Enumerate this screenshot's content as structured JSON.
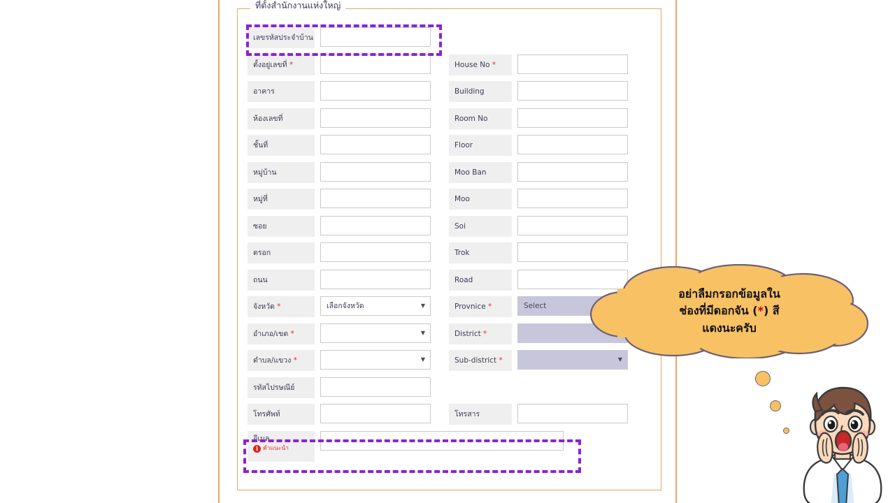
{
  "fieldset": {
    "legend": "ที่ตั้งสำนักงานแห่งใหญ่"
  },
  "form": {
    "rows": [
      {
        "th_label": "เลขรหัสประจำบ้าน",
        "th_required": true,
        "th_control": "text",
        "th_value": "",
        "en_label": "",
        "en_required": false,
        "en_control": "none",
        "en_value": "",
        "highlight": true
      },
      {
        "th_label": "ตั้งอยู่เลขที่",
        "th_required": true,
        "th_control": "text",
        "th_value": "",
        "en_label": "House No",
        "en_required": true,
        "en_control": "text",
        "en_value": ""
      },
      {
        "th_label": "อาคาร",
        "th_required": false,
        "th_control": "text",
        "th_value": "",
        "en_label": "Building",
        "en_required": false,
        "en_control": "text",
        "en_value": ""
      },
      {
        "th_label": "ห้องเลขที่",
        "th_required": false,
        "th_control": "text",
        "th_value": "",
        "en_label": "Room No",
        "en_required": false,
        "en_control": "text",
        "en_value": ""
      },
      {
        "th_label": "ชั้นที่",
        "th_required": false,
        "th_control": "text",
        "th_value": "",
        "en_label": "Floor",
        "en_required": false,
        "en_control": "text",
        "en_value": ""
      },
      {
        "th_label": "หมู่บ้าน",
        "th_required": false,
        "th_control": "text",
        "th_value": "",
        "en_label": "Moo Ban",
        "en_required": false,
        "en_control": "text",
        "en_value": ""
      },
      {
        "th_label": "หมู่ที่",
        "th_required": false,
        "th_control": "text",
        "th_value": "",
        "en_label": "Moo",
        "en_required": false,
        "en_control": "text",
        "en_value": ""
      },
      {
        "th_label": "ซอย",
        "th_required": false,
        "th_control": "text",
        "th_value": "",
        "en_label": "Soi",
        "en_required": false,
        "en_control": "text",
        "en_value": ""
      },
      {
        "th_label": "ตรอก",
        "th_required": false,
        "th_control": "text",
        "th_value": "",
        "en_label": "Trok",
        "en_required": false,
        "en_control": "text",
        "en_value": ""
      },
      {
        "th_label": "ถนน",
        "th_required": false,
        "th_control": "text",
        "th_value": "",
        "en_label": "Road",
        "en_required": false,
        "en_control": "text",
        "en_value": ""
      },
      {
        "th_label": "จังหวัด",
        "th_required": true,
        "th_control": "select",
        "th_value": "เลือกจังหวัด",
        "en_label": "Provnice",
        "en_required": true,
        "en_control": "select-lav",
        "en_value": "Select"
      },
      {
        "th_label": "อำเภอ/เขต",
        "th_required": true,
        "th_control": "select",
        "th_value": "",
        "en_label": "District",
        "en_required": true,
        "en_control": "select-lav",
        "en_value": ""
      },
      {
        "th_label": "ตำบล/แขวง",
        "th_required": true,
        "th_control": "select",
        "th_value": "",
        "en_label": "Sub-district",
        "en_required": true,
        "en_control": "select-lav",
        "en_value": ""
      },
      {
        "th_label": "รหัสไปรษณีย์",
        "th_required": false,
        "th_control": "text",
        "th_value": "",
        "en_label": "",
        "en_required": false,
        "en_control": "none",
        "en_value": ""
      },
      {
        "th_label": "โทรศัพท์",
        "th_required": false,
        "th_control": "text",
        "th_value": "",
        "en_label": "โทรสาร",
        "en_required": false,
        "en_control": "text",
        "en_value": ""
      }
    ],
    "email_row": {
      "label": "อีเมล",
      "hint": "คำแนะนำ",
      "hint_icon": "info-icon",
      "hint_icon_glyph": "i",
      "value": "",
      "highlight": true
    }
  },
  "annotation": {
    "bubble_line1": "อย่าลืมกรอกข้อมูลใน",
    "bubble_line2_a": "ช่องที่มีดอกจัน (",
    "bubble_line2_star": "*",
    "bubble_line2_b": ") สี",
    "bubble_line3": "แดงนะครับ",
    "character": "excited-man-illustration"
  },
  "colors": {
    "frame_orange": "#e8a566",
    "highlight_purple": "#8b22d6",
    "required_red": "#e03030",
    "label_grey": "#efefef",
    "select_lavender": "#c7c6da",
    "bubble_amber": "#f7c164"
  },
  "icons": {
    "caret": "▼"
  }
}
